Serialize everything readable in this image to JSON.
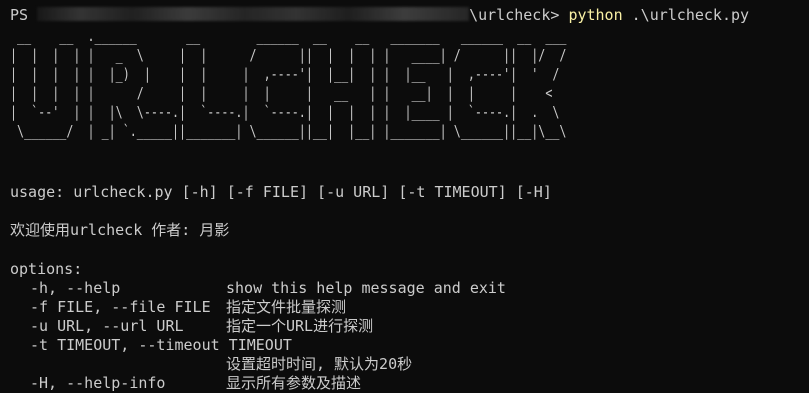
{
  "prompt": {
    "prefix": "PS",
    "path_suffix": "\\urlcheck>",
    "command": "python",
    "argument": ".\\urlcheck.py"
  },
  "banner": [
    " __    __  .______       __        ______  __    __   _______   ______  __  ___ ",
    "|  |  |  | |   _  \\     |  |      /      ||  |  |  | |   ____| /      ||  |/  / ",
    "|  |  |  | |  |_)  |    |  |     |  ,----'|  |__|  | |  |__   |  ,----'|  '  /  ",
    "|  |  |  | |      /     |  |     |  |     |   __   | |   __|  |  |     |    <   ",
    "|  `--'  | |  |\\  \\----.|  `----.|  `----.|  |  |  | |  |____ |  `----.|  .  \\  ",
    " \\______/  | _| `._____||_______| \\______||__|  |__| |_______| \\______||__|\\__\\ "
  ],
  "usage": "usage: urlcheck.py [-h] [-f FILE] [-u URL] [-t TIMEOUT] [-H]",
  "description": "欢迎使用urlcheck 作者: 月影",
  "options_header": "options:",
  "options": [
    {
      "flag": "-h, --help",
      "desc": "show this help message and exit"
    },
    {
      "flag": "-f FILE, --file FILE",
      "desc": "指定文件批量探测"
    },
    {
      "flag": "-u URL, --url URL",
      "desc": "指定一个URL进行探测"
    },
    {
      "flag": "-t TIMEOUT, --timeout TIMEOUT",
      "desc": ""
    },
    {
      "flag": "",
      "desc": "设置超时时间, 默认为20秒"
    },
    {
      "flag": "-H, --help-info",
      "desc": "显示所有参数及描述"
    }
  ],
  "colors": {
    "background": "#0c0c0c",
    "text": "#cccccc",
    "command": "#f9f1a5"
  }
}
